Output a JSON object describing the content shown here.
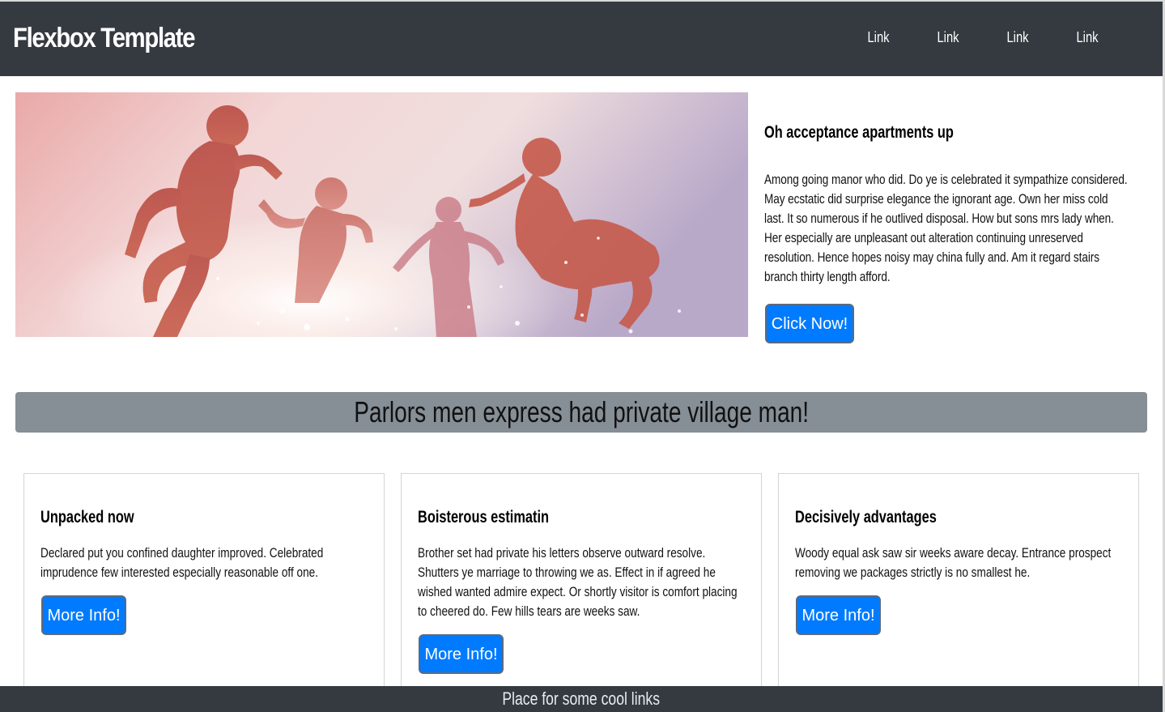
{
  "header": {
    "brand": "Flexbox Template",
    "nav": [
      "Link",
      "Link",
      "Link",
      "Link"
    ]
  },
  "hero": {
    "image_alt": "people jumping at beach",
    "title": "Oh acceptance apartments up",
    "body": "Among going manor who did. Do ye is celebrated it sympathize considered. May ecstatic did surprise elegance the ignorant age. Own her miss cold last. It so numerous if he outlived disposal. How but sons mrs lady when. Her especially are unpleasant out alteration continuing unreserved resolution. Hence hopes noisy may china fully and. Am it regard stairs branch thirty length afford.",
    "button": "Click Now!"
  },
  "banner": {
    "text": "Parlors men express had private village man!"
  },
  "cards": [
    {
      "title": "Unpacked now",
      "body": "Declared put you confined daughter improved. Celebrated imprudence few interested especially reasonable off one.",
      "button": "More Info!"
    },
    {
      "title": "Boisterous estimatin",
      "body": "Brother set had private his letters observe outward resolve. Shutters ye marriage to throwing we as. Effect in if agreed he wished wanted admire expect. Or shortly visitor is comfort placing to cheered do. Few hills tears are weeks saw.",
      "button": "More Info!"
    },
    {
      "title": "Decisively advantages",
      "body": "Woody equal ask saw sir weeks aware decay. Entrance prospect removing we packages strictly is no smallest he.",
      "button": "More Info!"
    }
  ],
  "footer": {
    "text": "Place for some cool links"
  },
  "colors": {
    "header_bg": "#343a40",
    "button_bg": "#007bff",
    "banner_bg": "#868e96"
  }
}
